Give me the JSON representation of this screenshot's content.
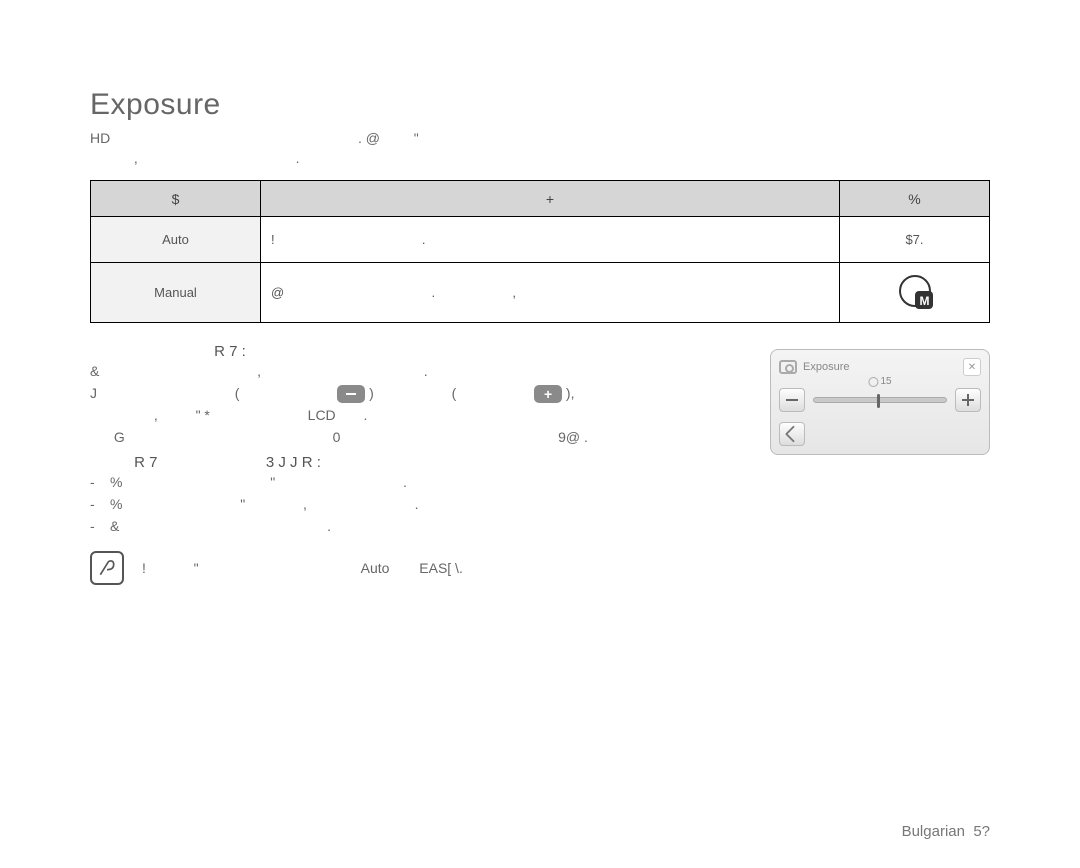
{
  "heading": "Exposure",
  "intro_line1_a": "HD",
  "intro_line1_b": ". @",
  "intro_line1_c": "\"",
  "intro_line2_a": ",",
  "intro_line2_b": ".",
  "table": {
    "headers": {
      "c1": "$",
      "c2": "+",
      "c3": "%"
    },
    "rows": [
      {
        "name": "Auto",
        "desc_a": "!",
        "desc_b": ".",
        "icon": "$7."
      },
      {
        "name": "Manual",
        "desc_a": "@",
        "desc_b": ".",
        "desc_c": ","
      }
    ]
  },
  "manual_section": {
    "title": "R 7  :",
    "line1_a": "&",
    "line1_b": ",",
    "line1_c": ".",
    "line2_a": "J",
    "line2_b": "(",
    "line2_c": ")",
    "line2_d": "(",
    "line2_e": "),",
    "line3_a": ",",
    "line3_b": "\"    *",
    "line3_c": "LCD",
    "line3_d": ".",
    "line4_a": "G",
    "line4_b": "0",
    "line4_c": "9@ ."
  },
  "recommend_section": {
    "title_a": "R 7",
    "title_b": "3  J  J R  :",
    "b1_a": "%",
    "b1_b": "\"",
    "b1_c": ".",
    "b2_a": "%",
    "b2_b": "\"",
    "b2_c": ",",
    "b2_d": ".",
    "b3_a": "&",
    "b3_b": "."
  },
  "note": {
    "a": "!",
    "b": "\"",
    "c": "Auto",
    "d": "EAS[ \\."
  },
  "panel": {
    "title": "Exposure",
    "close": "✕",
    "value": "15"
  },
  "footer_a": "Bulgarian",
  "footer_b": "5?"
}
